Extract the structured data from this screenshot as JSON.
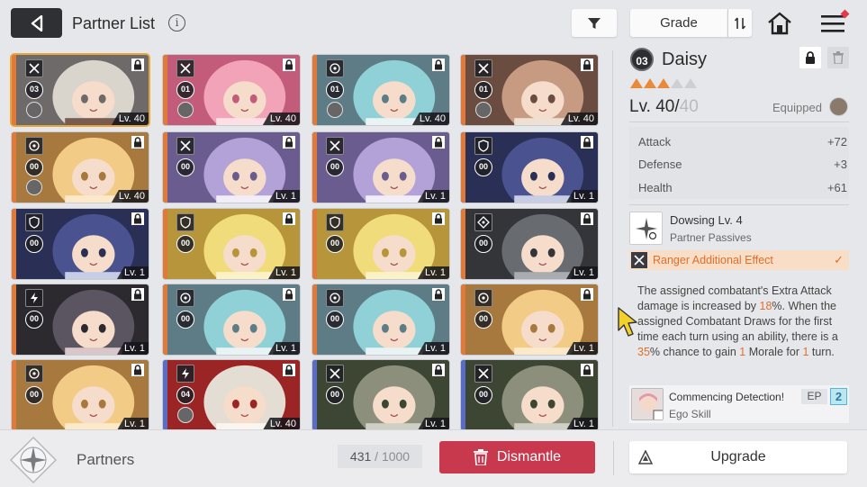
{
  "header": {
    "title": "Partner List",
    "info_icon": "info-icon",
    "grade_label": "Grade"
  },
  "partners": [
    {
      "count": "03",
      "level": "Lv. 40",
      "class": "crossed-swords",
      "palette": "grey",
      "selected": true,
      "ego": true
    },
    {
      "count": "01",
      "level": "Lv. 40",
      "class": "crossed-swords",
      "palette": "pink",
      "selected": false,
      "ego": true
    },
    {
      "count": "01",
      "level": "Lv. 40",
      "class": "target",
      "palette": "teal",
      "selected": false,
      "ego": true
    },
    {
      "count": "01",
      "level": "Lv. 40",
      "class": "crossed-swords",
      "palette": "brown",
      "selected": false,
      "ego": true
    },
    {
      "count": "00",
      "level": "Lv. 40",
      "class": "target",
      "palette": "blonde",
      "selected": false,
      "ego": true
    },
    {
      "count": "00",
      "level": "Lv. 1",
      "class": "crossed-swords",
      "palette": "purple",
      "selected": false,
      "ego": false
    },
    {
      "count": "00",
      "level": "Lv. 1",
      "class": "crossed-swords",
      "palette": "purple",
      "selected": false,
      "ego": false
    },
    {
      "count": "00",
      "level": "Lv. 1",
      "class": "shield",
      "palette": "navy",
      "selected": false,
      "ego": false
    },
    {
      "count": "00",
      "level": "Lv. 1",
      "class": "shield",
      "palette": "navy",
      "selected": false,
      "ego": false
    },
    {
      "count": "00",
      "level": "Lv. 1",
      "class": "shield",
      "palette": "yellow",
      "selected": false,
      "ego": false
    },
    {
      "count": "00",
      "level": "Lv. 1",
      "class": "shield",
      "palette": "yellow",
      "selected": false,
      "ego": false
    },
    {
      "count": "00",
      "level": "Lv. 1",
      "class": "ranger",
      "palette": "dark",
      "selected": false,
      "ego": false
    },
    {
      "count": "00",
      "level": "Lv. 1",
      "class": "lightning",
      "palette": "black",
      "selected": false,
      "ego": false
    },
    {
      "count": "00",
      "level": "Lv. 1",
      "class": "target",
      "palette": "teal",
      "selected": false,
      "ego": false
    },
    {
      "count": "00",
      "level": "Lv. 1",
      "class": "target",
      "palette": "teal",
      "selected": false,
      "ego": false
    },
    {
      "count": "00",
      "level": "Lv. 1",
      "class": "target",
      "palette": "blonde",
      "selected": false,
      "ego": false
    },
    {
      "count": "00",
      "level": "Lv. 1",
      "class": "target",
      "palette": "blonde",
      "selected": false,
      "ego": false
    },
    {
      "count": "04",
      "level": "Lv. 40",
      "class": "lightning",
      "palette": "white-red",
      "selected": false,
      "ego": true
    },
    {
      "count": "00",
      "level": "Lv. 1",
      "class": "crossed-swords",
      "palette": "olive",
      "selected": false,
      "ego": false
    },
    {
      "count": "00",
      "level": "Lv. 1",
      "class": "crossed-swords",
      "palette": "olive",
      "selected": false,
      "ego": false
    }
  ],
  "detail": {
    "number": "03",
    "name": "Daisy",
    "stars_filled": 3,
    "stars_total": 5,
    "level_current": "Lv. 40/",
    "level_max": "40",
    "equipped_label": "Equipped",
    "stats": [
      {
        "label": "Attack",
        "value": "+72"
      },
      {
        "label": "Defense",
        "value": "+3"
      },
      {
        "label": "Health",
        "value": "+61"
      }
    ],
    "skill_name": "Dowsing Lv. 4",
    "skill_type": "Partner Passives",
    "ranger_label": "Ranger Additional Effect",
    "description_parts": [
      {
        "text": "The assigned combatant's Extra Attack damage is increased by ",
        "hl": false
      },
      {
        "text": "18",
        "hl": true
      },
      {
        "text": "%. When the assigned Combatant Draws for the first time each turn using an ability, there is a ",
        "hl": false
      },
      {
        "text": "35",
        "hl": true
      },
      {
        "text": "% chance to gain ",
        "hl": false
      },
      {
        "text": "1",
        "hl": true
      },
      {
        "text": " Morale for ",
        "hl": false
      },
      {
        "text": "1",
        "hl": true
      },
      {
        "text": " turn.",
        "hl": false
      }
    ],
    "ego_name": "Commencing Detection!",
    "ego_type": "Ego Skill",
    "ep_label": "EP",
    "ep_value": "2"
  },
  "footer": {
    "partners_label": "Partners",
    "count_current": "431",
    "count_sep": " / ",
    "count_total": "1000",
    "dismantle_label": "Dismantle",
    "upgrade_label": "Upgrade"
  },
  "colors": {
    "accent_orange": "#e06f2c",
    "dismantle_red": "#c9394e",
    "selected_outline": "#e6a83c"
  }
}
